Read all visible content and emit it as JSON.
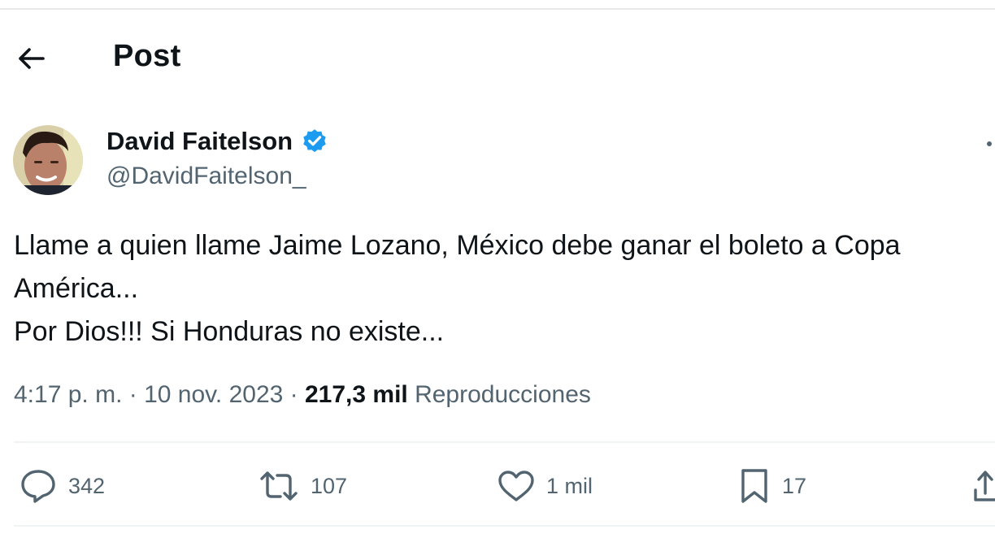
{
  "header": {
    "title": "Post",
    "back_icon": "arrow-left-icon"
  },
  "author": {
    "name": "David Faitelson",
    "handle": "@DavidFaitelson_",
    "verified": true,
    "verified_color": "#1d9bf0"
  },
  "post": {
    "lines": [
      "Llame a quien llame Jaime Lozano, México debe ganar el boleto a Copa",
      "América...",
      "Por Dios!!! Si Honduras no existe..."
    ]
  },
  "meta": {
    "time": "4:17 p. m. · 10 nov. 2023 · ",
    "views_count": "217,3 mil",
    "views_label": " Reproducciones"
  },
  "actions": {
    "replies": "342",
    "reposts": "107",
    "likes": "1 mil",
    "bookmarks": "17"
  },
  "colors": {
    "text": "#0f1419",
    "secondary": "#536471",
    "divider": "#eff3f4"
  }
}
